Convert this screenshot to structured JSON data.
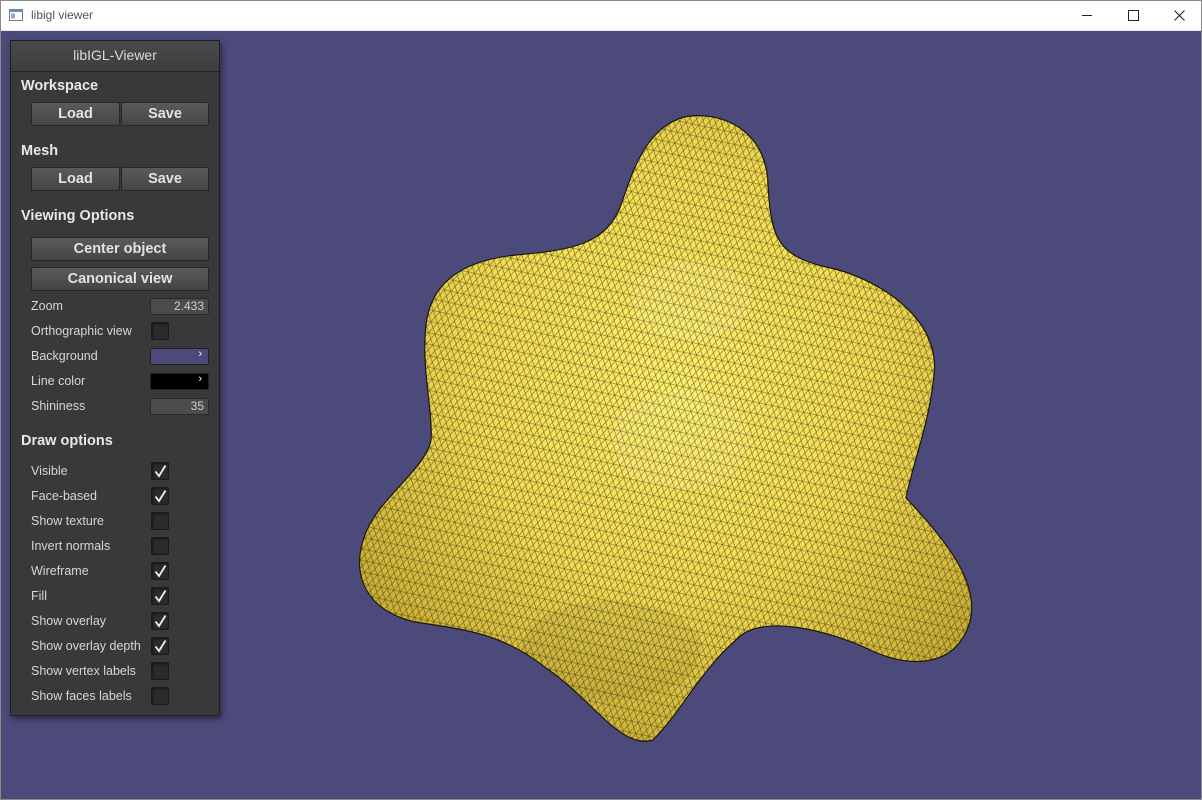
{
  "window": {
    "title": "libigl viewer",
    "icons": [
      "app-icon",
      "minimize-icon",
      "maximize-icon",
      "close-icon"
    ]
  },
  "colors": {
    "viewport_background": "#4c4a7b",
    "mesh_fill": "#f5e15a",
    "wireframe": "#000000",
    "panel_background": "#39393b"
  },
  "panel": {
    "title": "libIGL-Viewer",
    "workspace": {
      "title": "Workspace",
      "load_label": "Load",
      "save_label": "Save"
    },
    "mesh": {
      "title": "Mesh",
      "load_label": "Load",
      "save_label": "Save"
    },
    "viewing": {
      "title": "Viewing Options",
      "center_label": "Center object",
      "canonical_label": "Canonical view",
      "zoom_label": "Zoom",
      "zoom_value": "2.433",
      "ortho_label": "Orthographic view",
      "ortho_checked": false,
      "background_label": "Background",
      "background_color": "#4c4a7b",
      "linecolor_label": "Line color",
      "line_color": "#000000",
      "shininess_label": "Shininess",
      "shininess_value": "35"
    },
    "draw": {
      "title": "Draw options",
      "options": [
        {
          "label": "Visible",
          "checked": true
        },
        {
          "label": "Face-based",
          "checked": true
        },
        {
          "label": "Show texture",
          "checked": false
        },
        {
          "label": "Invert normals",
          "checked": false
        },
        {
          "label": "Wireframe",
          "checked": true
        },
        {
          "label": "Fill",
          "checked": true
        },
        {
          "label": "Show overlay",
          "checked": true
        },
        {
          "label": "Show overlay depth",
          "checked": true
        },
        {
          "label": "Show vertex labels",
          "checked": false
        },
        {
          "label": "Show faces labels",
          "checked": false
        }
      ]
    }
  }
}
